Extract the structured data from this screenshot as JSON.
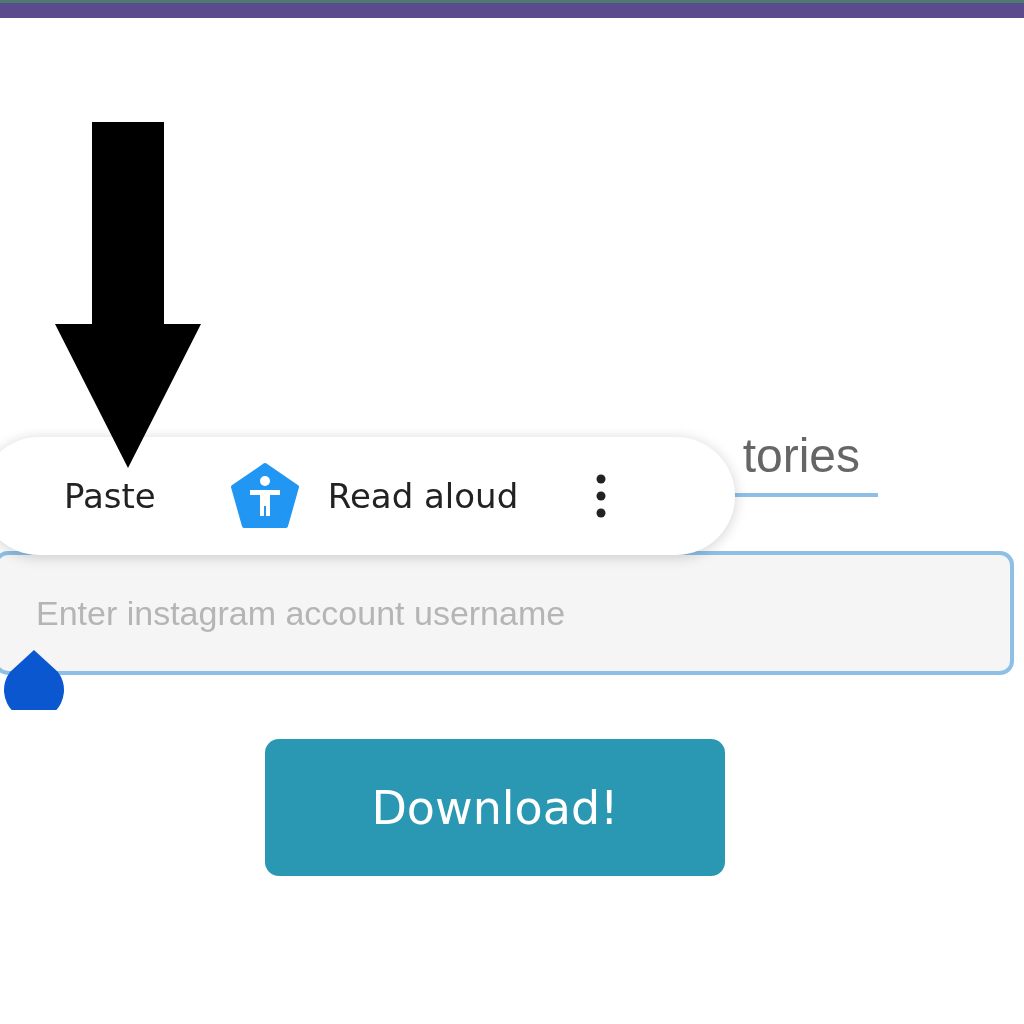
{
  "tab": {
    "label": "tories",
    "selected": true
  },
  "username_field": {
    "placeholder": "Enter instagram account username"
  },
  "download_button": {
    "label": "Download!"
  },
  "context_menu": {
    "items": [
      {
        "label": "Paste",
        "kind": "text"
      },
      {
        "label": "Read aloud",
        "kind": "accessibility"
      },
      {
        "kind": "more"
      }
    ]
  }
}
